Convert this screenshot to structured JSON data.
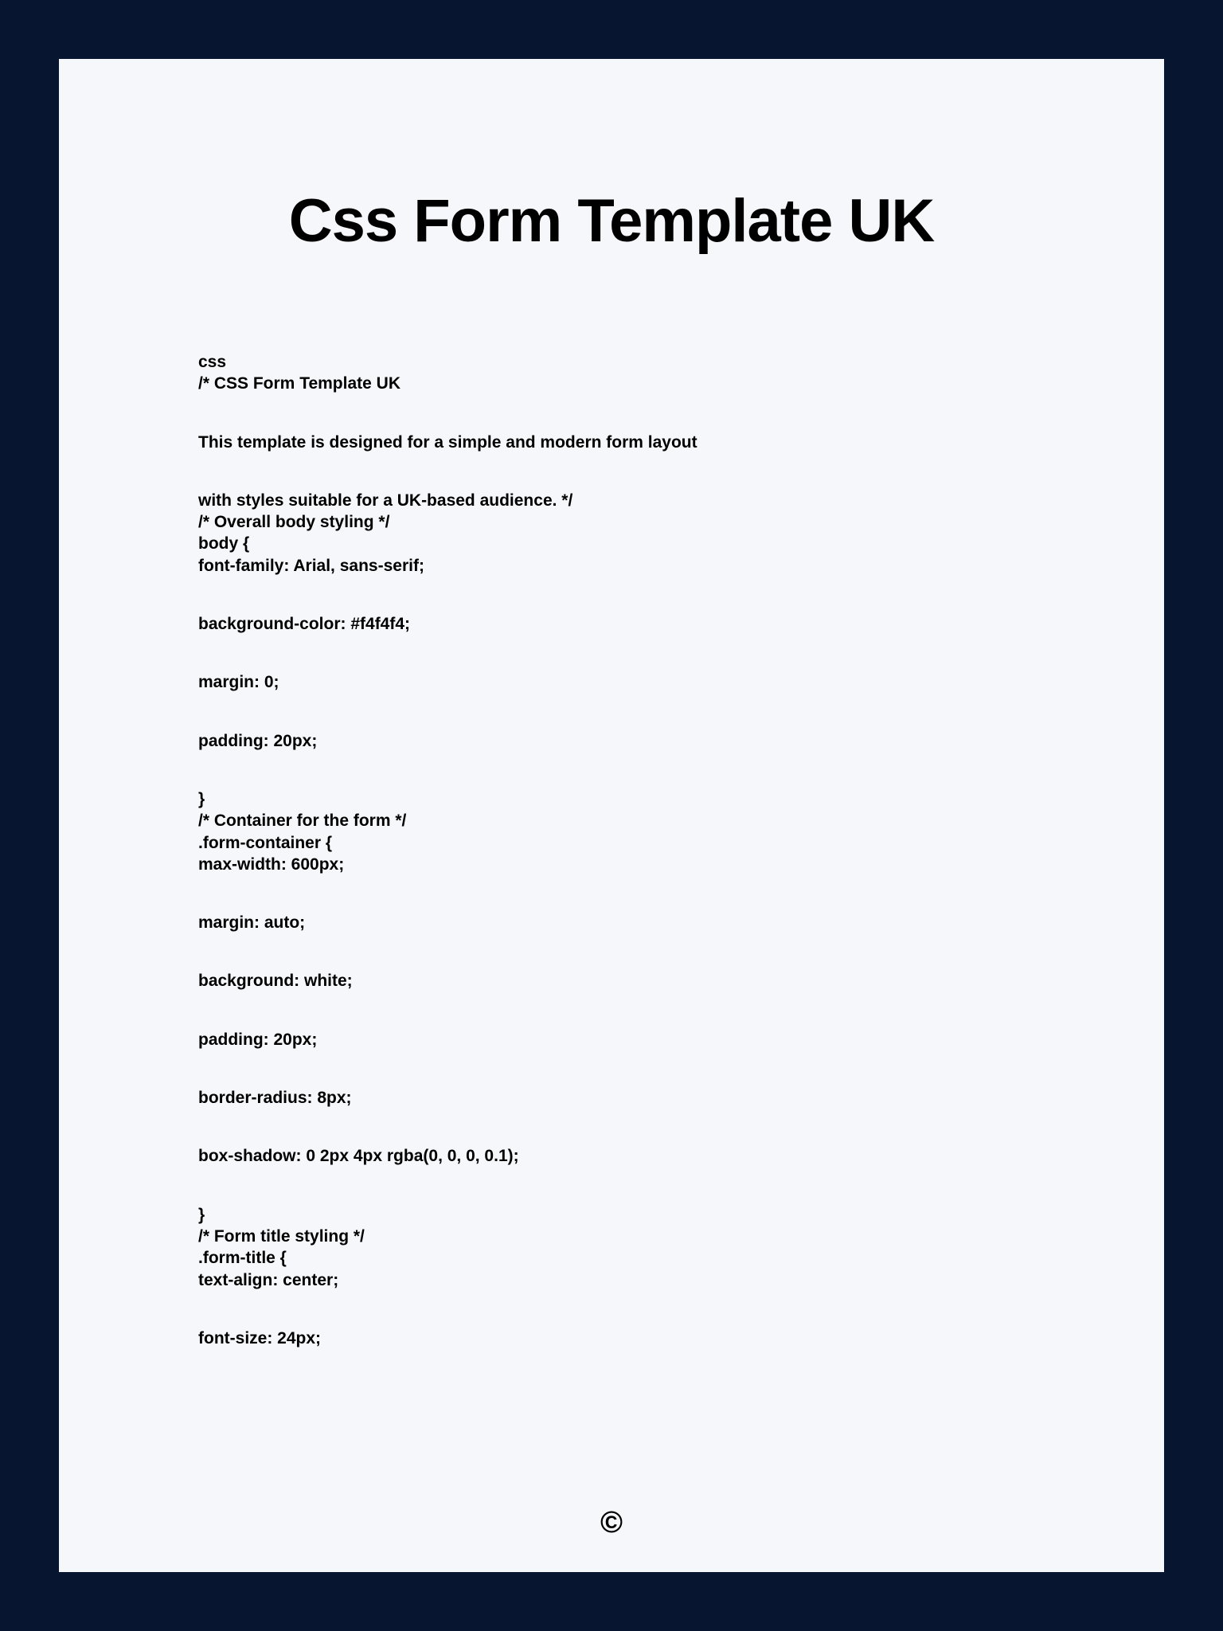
{
  "title": "Css Form Template UK",
  "lines": [
    {
      "text": "css",
      "spaced": false
    },
    {
      "text": "/* CSS Form Template UK",
      "spaced": false
    },
    {
      "text": "This template is designed for a simple and modern form layout",
      "spaced": true
    },
    {
      "text": "with styles suitable for a UK-based audience. */",
      "spaced": true
    },
    {
      "text": "/* Overall body styling */",
      "spaced": false
    },
    {
      "text": "body {",
      "spaced": false
    },
    {
      "text": "font-family: Arial, sans-serif;",
      "spaced": false
    },
    {
      "text": "background-color: #f4f4f4;",
      "spaced": true
    },
    {
      "text": "margin: 0;",
      "spaced": true
    },
    {
      "text": "padding: 20px;",
      "spaced": true
    },
    {
      "text": "}",
      "spaced": true
    },
    {
      "text": "/* Container for the form */",
      "spaced": false
    },
    {
      "text": ".form-container {",
      "spaced": false
    },
    {
      "text": "max-width: 600px;",
      "spaced": false
    },
    {
      "text": "margin: auto;",
      "spaced": true
    },
    {
      "text": "background: white;",
      "spaced": true
    },
    {
      "text": "padding: 20px;",
      "spaced": true
    },
    {
      "text": "border-radius: 8px;",
      "spaced": true
    },
    {
      "text": "box-shadow: 0 2px 4px rgba(0, 0, 0, 0.1);",
      "spaced": true
    },
    {
      "text": "}",
      "spaced": true
    },
    {
      "text": "/* Form title styling */",
      "spaced": false
    },
    {
      "text": ".form-title {",
      "spaced": false
    },
    {
      "text": "text-align: center;",
      "spaced": false
    },
    {
      "text": "font-size: 24px;",
      "spaced": true
    }
  ],
  "footer": "©"
}
